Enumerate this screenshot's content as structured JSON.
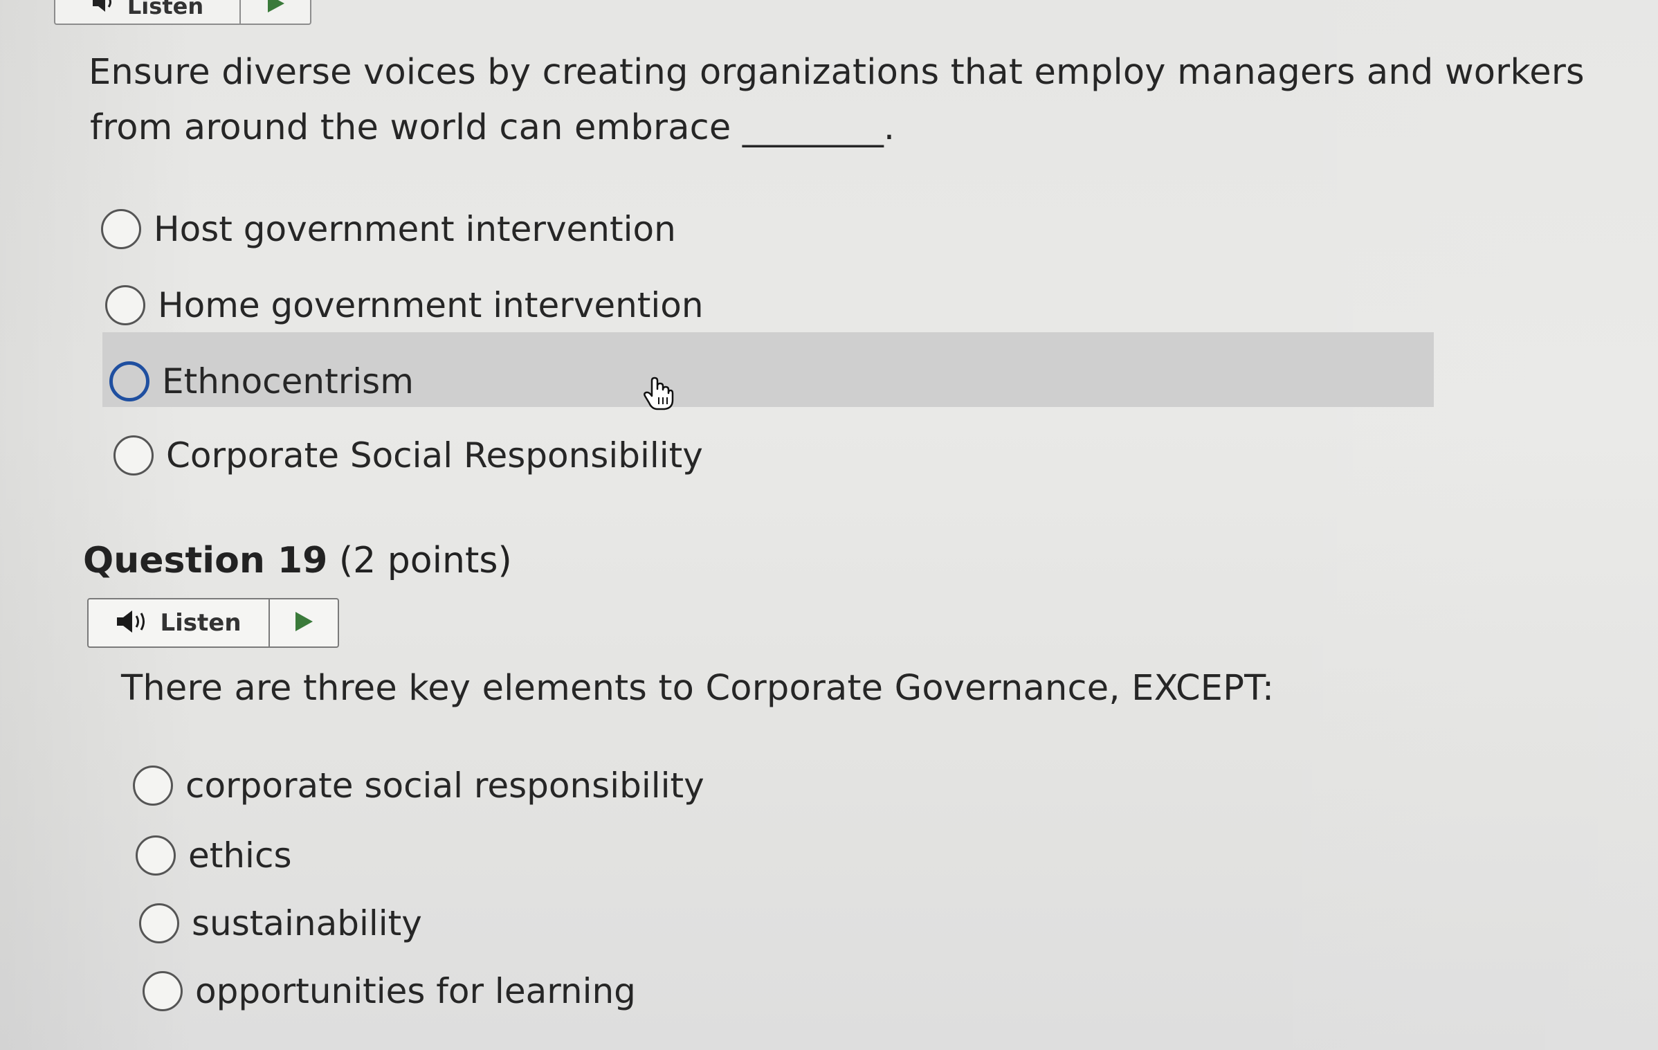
{
  "top_listen": {
    "label": "Listen"
  },
  "question18": {
    "text_line1": "Ensure diverse voices by creating organizations that employ managers and workers",
    "text_line2": "from around the world can embrace",
    "blank": "________.",
    "options": [
      {
        "label": "Host government intervention",
        "focused": false
      },
      {
        "label": "Home government intervention",
        "focused": false
      },
      {
        "label": "Ethnocentrism",
        "focused": true
      },
      {
        "label": "Corporate Social Responsibility",
        "focused": false
      }
    ]
  },
  "question19": {
    "title": "Question 19",
    "points": "(2 points)",
    "listen_label": "Listen",
    "text": "There are three key elements to Corporate Governance, EXCEPT:",
    "options": [
      {
        "label": "corporate social responsibility"
      },
      {
        "label": "ethics"
      },
      {
        "label": "sustainability"
      },
      {
        "label": "opportunities for learning"
      }
    ]
  },
  "colors": {
    "focus_ring": "#1f4fa0",
    "hover_row": "#cfcfcf",
    "play_icon": "#3a7a3a"
  }
}
